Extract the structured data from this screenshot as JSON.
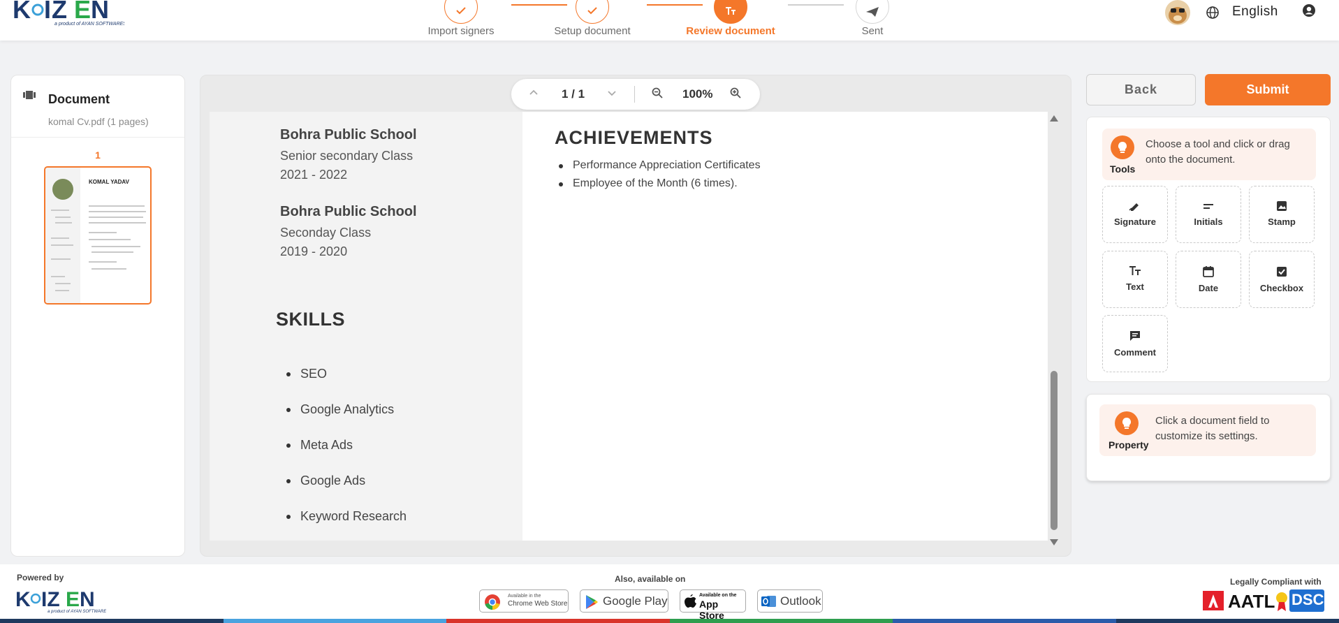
{
  "header": {
    "logo_text": "KAIZEN",
    "logo_tagline": "a product of AYAN SOFTWARES",
    "language": "English",
    "steps": [
      {
        "label": "Import signers",
        "state": "done"
      },
      {
        "label": "Setup document",
        "state": "done"
      },
      {
        "label": "Review document",
        "state": "active"
      },
      {
        "label": "Sent",
        "state": "pending"
      }
    ]
  },
  "left_panel": {
    "title": "Document",
    "subtitle": "komal Cv.pdf (1 pages)",
    "page_number": "1",
    "thumb_name": "KOMAL YADAV"
  },
  "viewer": {
    "page_indicator": "1 / 1",
    "zoom": "100%",
    "education": [
      {
        "school": "Bohra Public School",
        "class": "Senior secondary Class",
        "years": "2021 - 2022"
      },
      {
        "school": "Bohra Public School",
        "class": "Seconday Class",
        "years": "2019 - 2020"
      }
    ],
    "skills_heading": "SKILLS",
    "skills": [
      "SEO",
      "Google Analytics",
      "Meta Ads",
      "Google Ads",
      "Keyword Research"
    ],
    "achievements_heading": "ACHIEVEMENTS",
    "achievements": [
      "Performance Appreciation Certificates",
      "Employee of the Month (6 times)."
    ],
    "scroll_position": 0.92
  },
  "right_panel": {
    "back_label": "Back",
    "submit_label": "Submit",
    "tools_label": "Tools",
    "tools_hint": "Choose a tool and click or drag onto the document.",
    "tools": [
      {
        "label": "Signature",
        "icon": "signature-icon"
      },
      {
        "label": "Initials",
        "icon": "initials-icon"
      },
      {
        "label": "Stamp",
        "icon": "stamp-icon"
      },
      {
        "label": "Text",
        "icon": "text-icon"
      },
      {
        "label": "Date",
        "icon": "calendar-icon"
      },
      {
        "label": "Checkbox",
        "icon": "checkbox-icon"
      },
      {
        "label": "Comment",
        "icon": "comment-icon"
      }
    ],
    "property_label": "Property",
    "property_hint": "Click a document field to customize its settings."
  },
  "footer": {
    "powered_by": "Powered by",
    "also_available": "Also, available on",
    "stores": [
      {
        "label": "Chrome Web Store",
        "prefix": "Available in the"
      },
      {
        "label": "Google Play"
      },
      {
        "label": "App Store",
        "prefix": "Available on the"
      },
      {
        "label": "Outlook"
      }
    ],
    "legal": "Legally Compliant with",
    "aatl": "AATL",
    "dsc": "DSC"
  },
  "colors": {
    "accent": "#f4772a",
    "hint_bg": "#fdf1ec",
    "bottom_bar": [
      "#1f3a5f",
      "#4aa3df",
      "#d9342b",
      "#2e9e4f",
      "#2a5caa",
      "#1f3a5f"
    ]
  }
}
